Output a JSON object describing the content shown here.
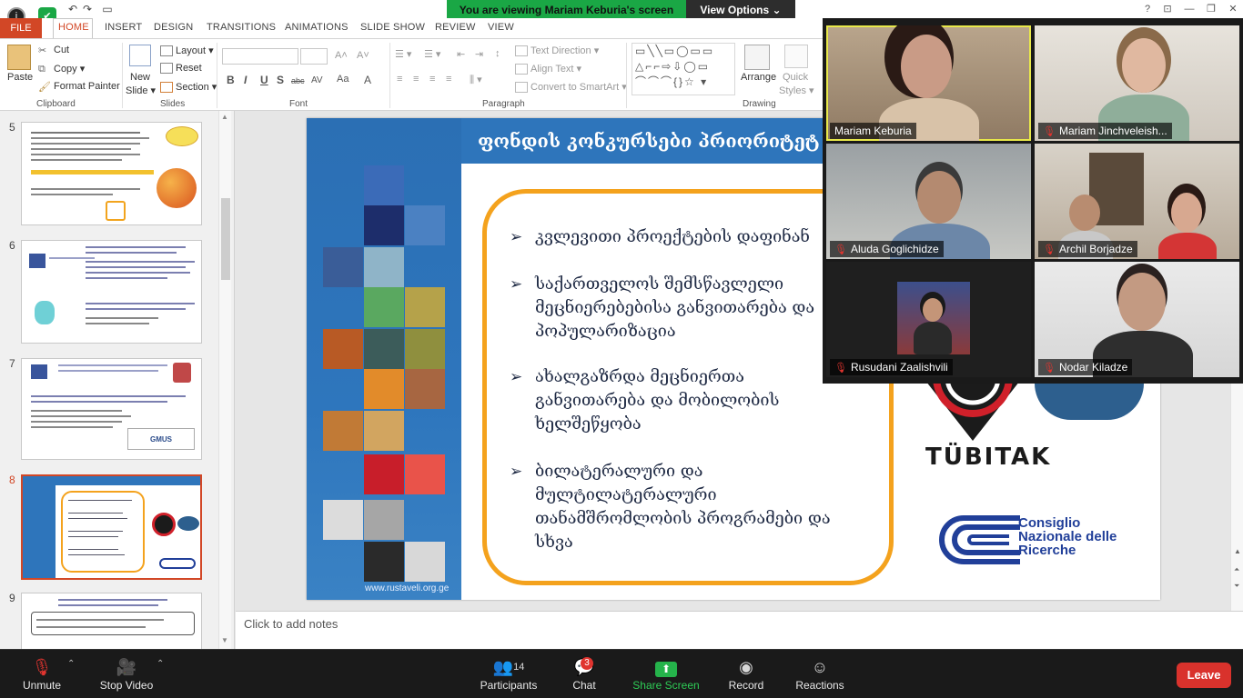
{
  "share_banner": {
    "message": "You are viewing Mariam Keburia's screen",
    "view_options": "View Options"
  },
  "ribbon": {
    "tabs": [
      "FILE",
      "HOME",
      "INSERT",
      "DESIGN",
      "TRANSITIONS",
      "ANIMATIONS",
      "SLIDE SHOW",
      "REVIEW",
      "VIEW"
    ],
    "clipboard": {
      "paste": "Paste",
      "cut": "Cut",
      "copy": "Copy",
      "format_painter": "Format Painter",
      "label": "Clipboard"
    },
    "slides": {
      "new_slide": "New",
      "new_slide_2": "Slide",
      "layout": "Layout",
      "reset": "Reset",
      "section": "Section",
      "label": "Slides"
    },
    "font": {
      "label": "Font",
      "bold": "B",
      "italic": "I",
      "underline": "U",
      "strike": "S",
      "shadow": "abc",
      "spacing": "AV",
      "case": "Aa",
      "color": "A"
    },
    "paragraph": {
      "text_direction": "Text Direction",
      "align_text": "Align Text",
      "convert_smartart": "Convert to SmartArt",
      "label": "Paragraph"
    },
    "drawing": {
      "arrange": "Arrange",
      "quick_styles": "Quick",
      "quick_styles_2": "Styles",
      "label": "Drawing"
    }
  },
  "thumbnails": [
    {
      "num": "5"
    },
    {
      "num": "6"
    },
    {
      "num": "7"
    },
    {
      "num": "8"
    },
    {
      "num": "9"
    }
  ],
  "slide": {
    "title": "ფონდის კონკურსები პრიორიტეტ",
    "bullets": [
      {
        "l1": "კვლევითი პროექტების დაფინან"
      },
      {
        "l1": "საქართველოს შემსწავლელი",
        "l2": "მეცნიერებებისა განვითარება და",
        "l3": "პოპულარიზაცია"
      },
      {
        "l1": "ახალგაზრდა მეცნიერთა",
        "l2": "განვითარება და მობილობის",
        "l3": "ხელშეწყობა"
      },
      {
        "l1": "ბილატერალური და",
        "l2": "მულტილატერალური",
        "l3": "თანამშრომლობის პროგრამები და",
        "l4": "სხვა"
      }
    ],
    "url": "www.rustaveli.org.ge",
    "tubitak": "TÜBITAK",
    "cnr_1": "Consiglio",
    "cnr_2": "Nazionale delle",
    "cnr_3": "Ricerche"
  },
  "notes_placeholder": "Click to add notes",
  "participants": [
    {
      "name": "Mariam Keburia",
      "muted": false,
      "active": true
    },
    {
      "name": "Mariam Jinchveleish...",
      "muted": true,
      "active": false
    },
    {
      "name": "Aluda Goglichidze",
      "muted": true,
      "active": false
    },
    {
      "name": "Archil Borjadze",
      "muted": true,
      "active": false
    },
    {
      "name": "Rusudani Zaalishvili",
      "muted": true,
      "active": false
    },
    {
      "name": "Nodar Kiladze",
      "muted": true,
      "active": false
    }
  ],
  "zoombar": {
    "unmute": "Unmute",
    "stop_video": "Stop Video",
    "participants": "Participants",
    "participants_count": "14",
    "chat": "Chat",
    "chat_badge": "3",
    "share_screen": "Share Screen",
    "record": "Record",
    "reactions": "Reactions",
    "leave": "Leave"
  }
}
